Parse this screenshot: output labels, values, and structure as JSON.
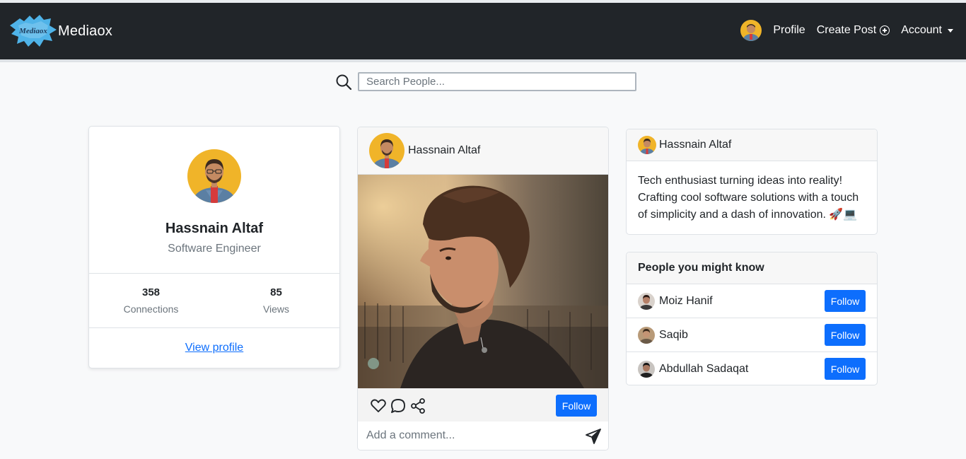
{
  "app": {
    "brand_name": "Mediaox",
    "logo_text": "Mediaox"
  },
  "navbar": {
    "profile_label": "Profile",
    "create_post_label": "Create Post",
    "account_label": "Account"
  },
  "search": {
    "placeholder": "Search People..."
  },
  "profile_card": {
    "name": "Hassnain Altaf",
    "role": "Software Engineer",
    "connections_count": "358",
    "connections_label": "Connections",
    "views_count": "85",
    "views_label": "Views",
    "view_profile_label": "View profile"
  },
  "post": {
    "author": "Hassnain Altaf",
    "follow_label": "Follow",
    "comment_placeholder": "Add a comment..."
  },
  "about": {
    "name": "Hassnain Altaf",
    "bio": "Tech enthusiast turning ideas into reality! Crafting cool software solutions with a touch of simplicity and a dash of innovation. 🚀💻"
  },
  "people": {
    "title": "People you might know",
    "items": [
      {
        "name": "Moiz Hanif",
        "follow_label": "Follow"
      },
      {
        "name": "Saqib",
        "follow_label": "Follow"
      },
      {
        "name": "Abdullah Sadaqat",
        "follow_label": "Follow"
      }
    ]
  },
  "colors": {
    "navbar_bg": "#212529",
    "page_bg": "#f8f9fa",
    "primary": "#0d6efd",
    "avatar_bg": "#f0b429"
  },
  "icons": [
    "search-icon",
    "plus-circle-icon",
    "caret-down-icon",
    "heart-icon",
    "comment-icon",
    "share-icon",
    "send-icon"
  ]
}
